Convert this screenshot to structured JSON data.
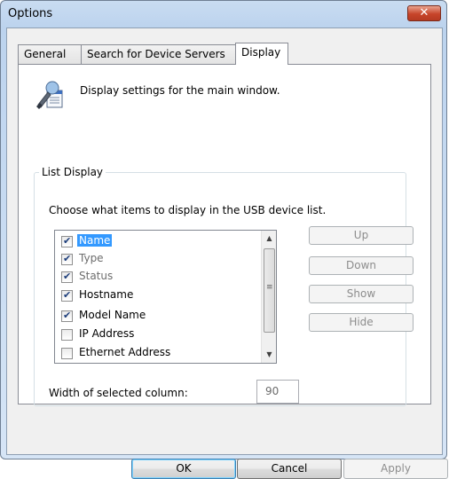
{
  "window": {
    "title": "Options",
    "close_glyph": "✕"
  },
  "tabs": [
    "General",
    "Search for Device Servers",
    "Display"
  ],
  "panel": {
    "description": "Display settings for the main window.",
    "group_label": "List Display",
    "instruction": "Choose what items to display in the USB device list.",
    "list_items": [
      {
        "label": "Name",
        "checked": true,
        "selected": true,
        "dim": false
      },
      {
        "label": "Type",
        "checked": true,
        "selected": false,
        "dim": true
      },
      {
        "label": "Status",
        "checked": true,
        "selected": false,
        "dim": true
      },
      {
        "label": "Hostname",
        "checked": true,
        "selected": false,
        "dim": false
      },
      {
        "label": "Model Name",
        "checked": true,
        "selected": false,
        "dim": false
      },
      {
        "label": "IP Address",
        "checked": false,
        "selected": false,
        "dim": false
      },
      {
        "label": "Ethernet Address",
        "checked": false,
        "selected": false,
        "dim": false
      }
    ],
    "side_buttons": [
      "Up",
      "Down",
      "Show",
      "Hide"
    ],
    "width_label": "Width of selected column:",
    "width_value": "90"
  },
  "buttons": {
    "ok": "OK",
    "cancel": "Cancel",
    "apply": "Apply"
  },
  "colors": {
    "selection": "#3399ff",
    "close": "#c7442a"
  }
}
